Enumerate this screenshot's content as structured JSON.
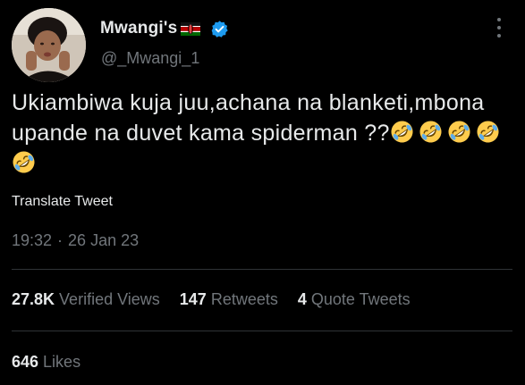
{
  "author": {
    "display_name": "Mwangi's",
    "handle": "@_Mwangi_1",
    "flag_icon": "kenya-flag-icon",
    "verified_icon": "verified-badge-icon",
    "verified_color": "#1d9bf0"
  },
  "tweet": {
    "text": "Ukiambiwa kuja juu,achana na blanketi,mbona upande na duvet kama spiderman ??",
    "emoji_icon": "rolling-on-floor-laughing-emoji",
    "emoji_count": 5
  },
  "translate_label": "Translate Tweet",
  "meta": {
    "time": "19:32",
    "separator": "·",
    "date": "26 Jan 23"
  },
  "stats": {
    "views_count": "27.8K",
    "views_label": "Verified Views",
    "retweets_count": "147",
    "retweets_label": "Retweets",
    "quotes_count": "4",
    "quotes_label": "Quote Tweets",
    "likes_count": "646",
    "likes_label": "Likes"
  },
  "colors": {
    "background": "#000000",
    "primary_text": "#e7e9ea",
    "secondary_text": "#71767b",
    "divider": "#2f3336"
  }
}
